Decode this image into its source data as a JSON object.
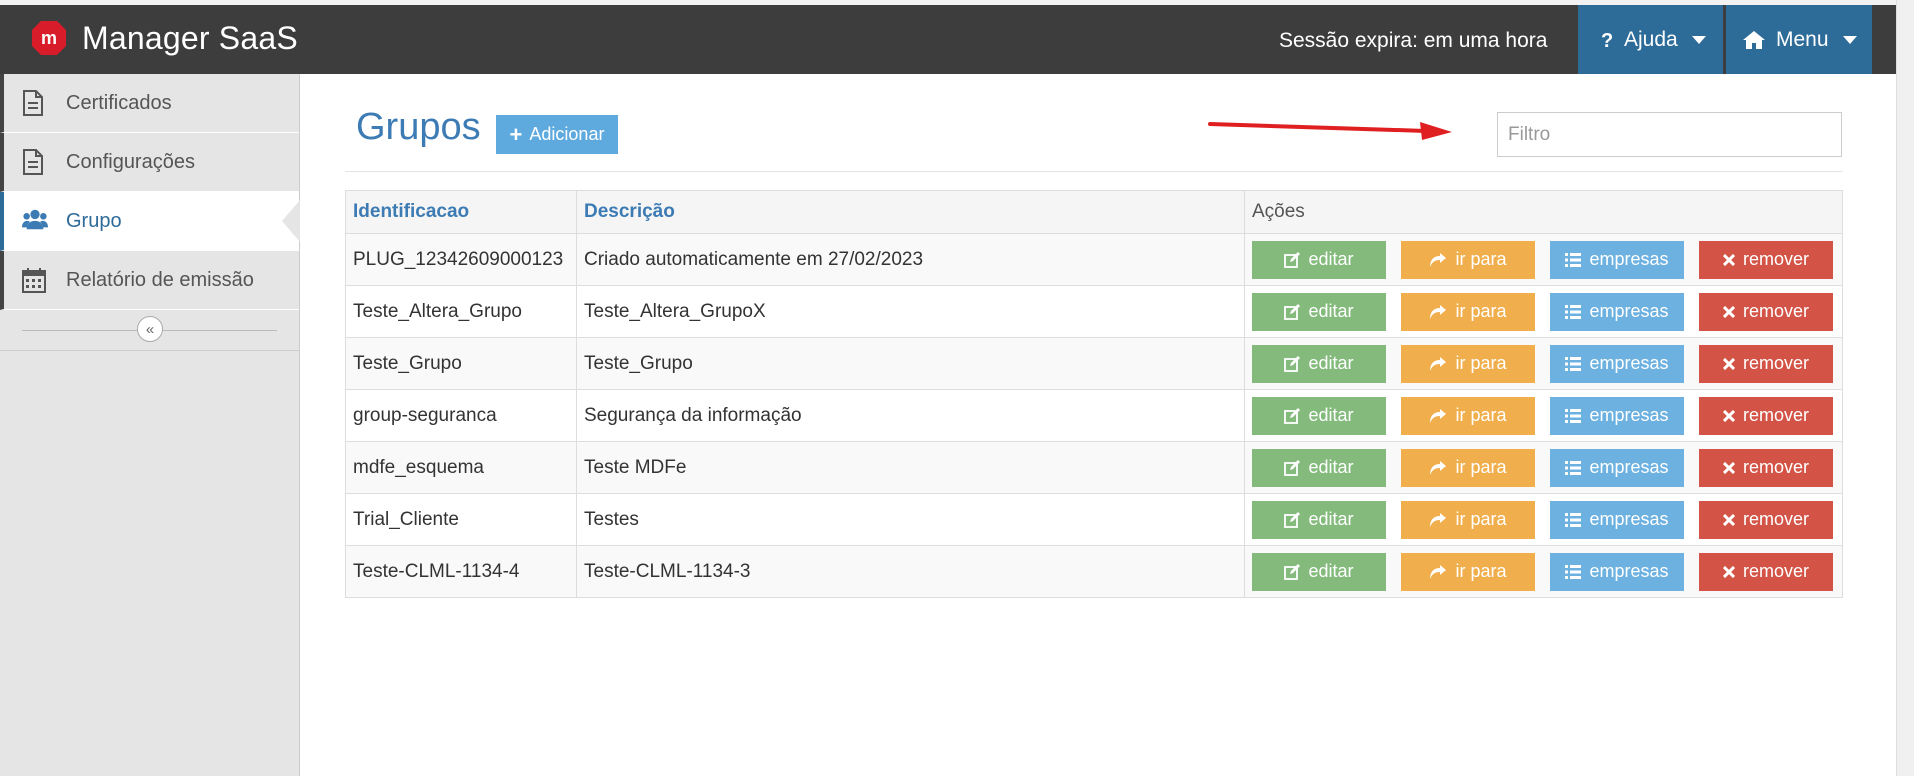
{
  "app": {
    "title": "Manager SaaS",
    "logo_icon": "m-logo-icon"
  },
  "header": {
    "session": "Sessão expira: em uma hora",
    "help_label": "Ajuda",
    "menu_label": "Menu"
  },
  "sidebar": {
    "items": [
      {
        "label": "Certificados",
        "icon": "document-icon",
        "active": false
      },
      {
        "label": "Configurações",
        "icon": "document-icon",
        "active": false
      },
      {
        "label": "Grupo",
        "icon": "users-icon",
        "active": true
      },
      {
        "label": "Relatório de emissão",
        "icon": "calendar-icon",
        "active": false
      }
    ],
    "collapse_glyph": "«"
  },
  "main": {
    "title": "Grupos",
    "add_label": "Adicionar",
    "filter_placeholder": "Filtro",
    "table": {
      "headers": [
        "Identificacao",
        "Descrição",
        "Ações"
      ],
      "rows": [
        {
          "id": "PLUG_12342609000123",
          "desc": "Criado automaticamente em 27/02/2023"
        },
        {
          "id": "Teste_Altera_Grupo",
          "desc": "Teste_Altera_GrupoX"
        },
        {
          "id": "Teste_Grupo",
          "desc": "Teste_Grupo"
        },
        {
          "id": "group-seguranca",
          "desc": "Segurança da informação"
        },
        {
          "id": "mdfe_esquema",
          "desc": "Teste MDFe"
        },
        {
          "id": "Trial_Cliente",
          "desc": "Testes"
        },
        {
          "id": "Teste-CLML-1134-4",
          "desc": "Teste-CLML-1134-3"
        }
      ],
      "actions": {
        "edit": "editar",
        "goto": "ir para",
        "companies": "empresas",
        "remove": "remover"
      }
    }
  },
  "colors": {
    "topbar": "#3d3d3d",
    "nav_button": "#2d6b99",
    "title_blue": "#3c7bb4",
    "edit": "#84bb7d",
    "goto": "#f0ae4d",
    "companies": "#6cb1e0",
    "remove": "#d35446",
    "annotation_arrow": "#e02020"
  }
}
